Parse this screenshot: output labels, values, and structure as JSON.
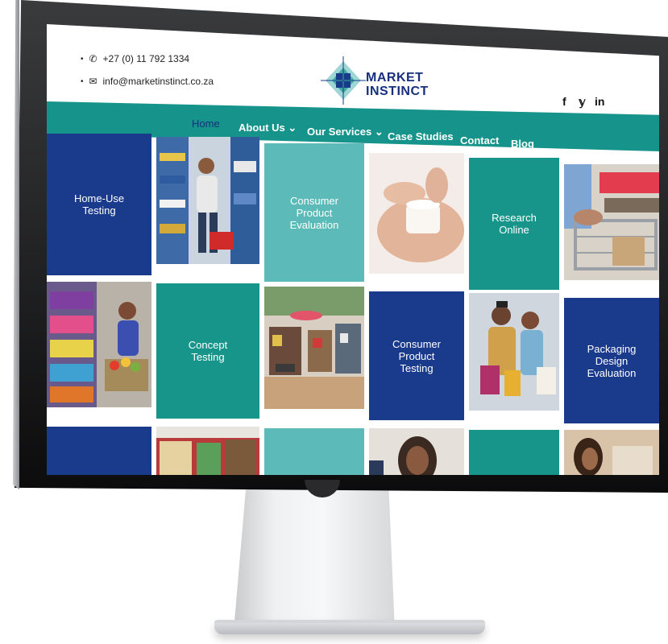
{
  "header": {
    "phone": "+27 (0) 11 792 1334",
    "email": "info@marketinstinct.co.za",
    "logo_line1": "MARKET",
    "logo_line2": "INSTINCT",
    "social": [
      "f",
      "𝕪",
      "in"
    ]
  },
  "nav": {
    "items": [
      "Home",
      "About Us ⌄",
      "Our Services ⌄",
      "Case Studies",
      "Contact",
      "Blog"
    ],
    "active": "Home"
  },
  "tiles": {
    "home_use": "Home-Use\nTesting",
    "consumer_eval": "Consumer\nProduct\nEvaluation",
    "research_online": "Research\nOnline",
    "concept_testing": "Concept\nTesting",
    "consumer_testing": "Consumer\nProduct\nTesting",
    "packaging": "Packaging\nDesign\nEvaluation"
  },
  "colors": {
    "navy": "#1a3a8c",
    "teal": "#17958b",
    "light_teal": "#5cbbb8",
    "nav_bar": "#16938a"
  }
}
